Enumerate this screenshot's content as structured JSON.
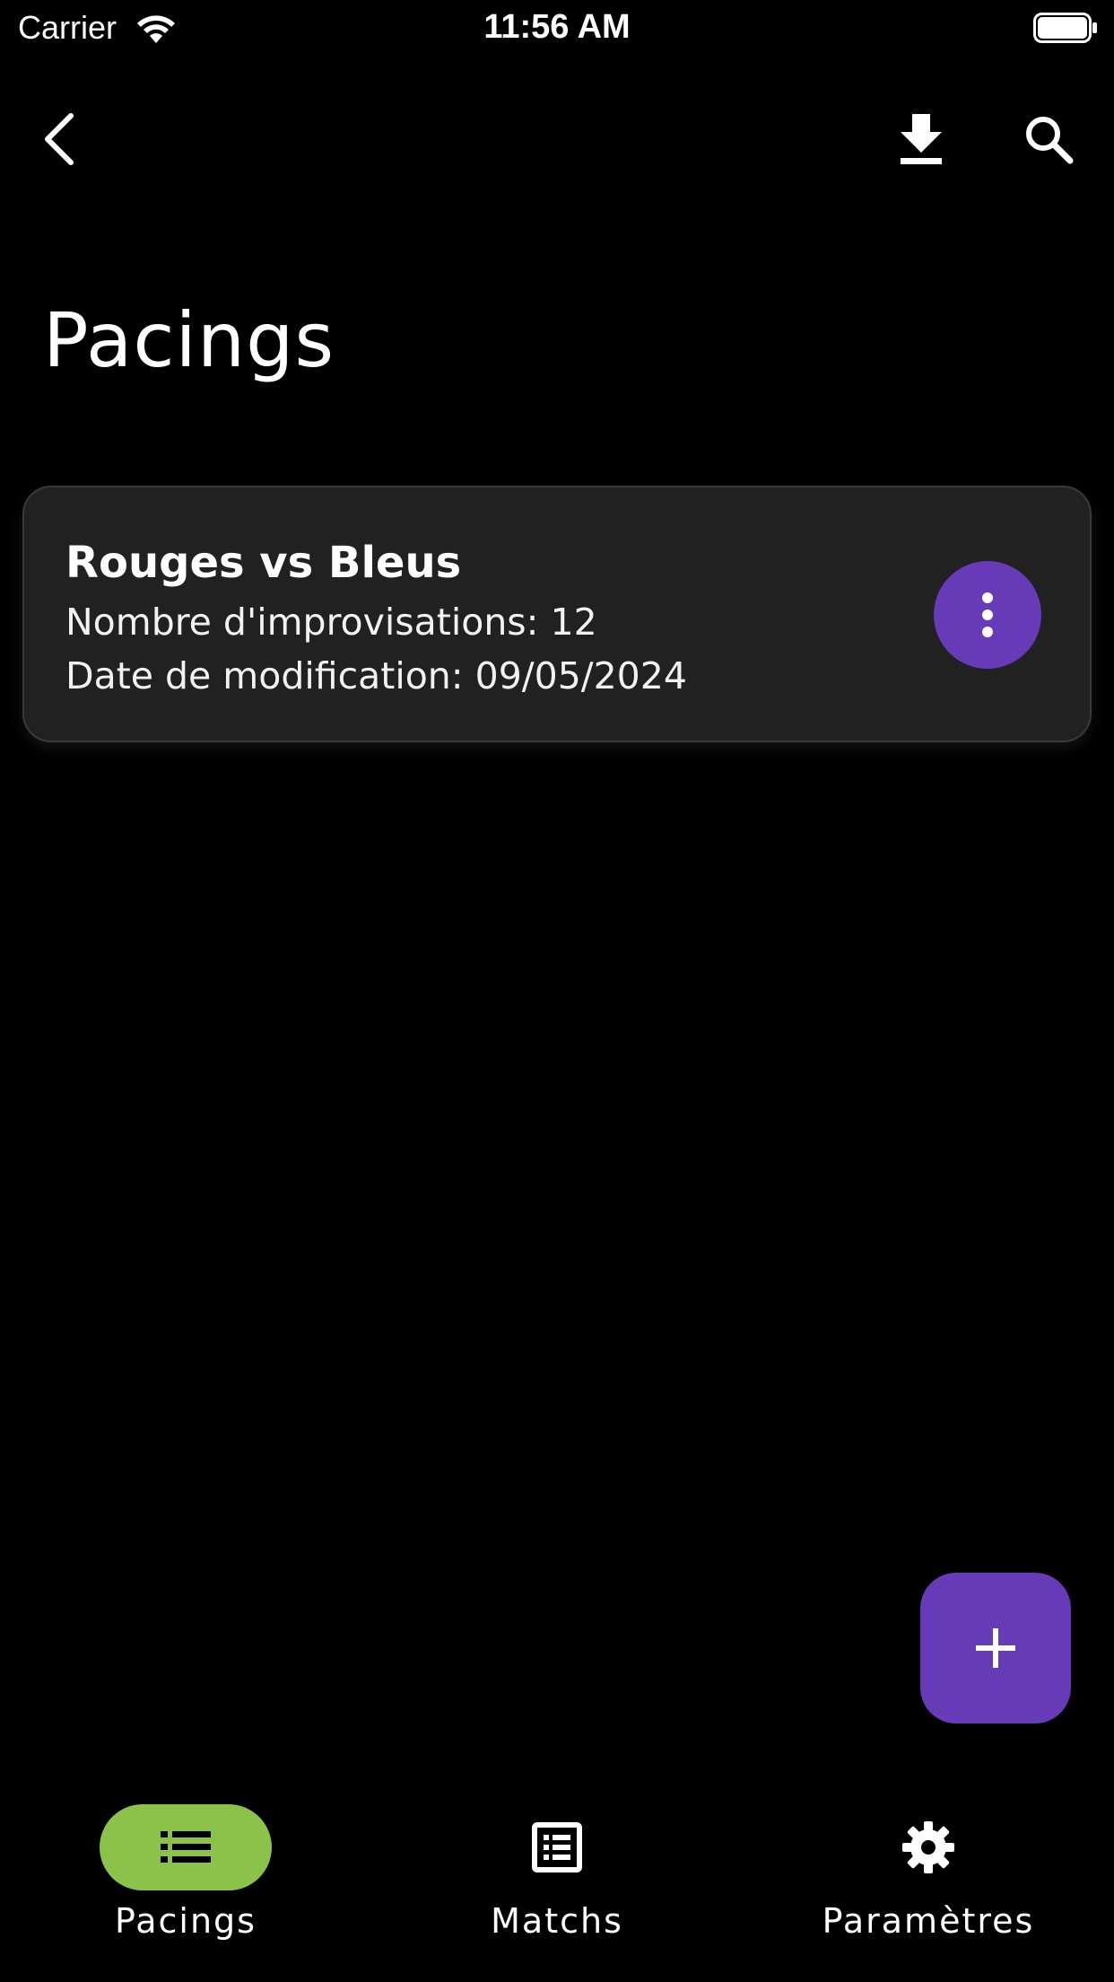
{
  "status_bar": {
    "carrier": "Carrier",
    "time": "11:56 AM"
  },
  "app_bar": {
    "back_icon": "arrow-back-icon",
    "download_icon": "download-icon",
    "search_icon": "search-icon"
  },
  "page": {
    "title": "Pacings"
  },
  "cards": [
    {
      "title": "Rouges vs Bleus",
      "line1": "Nombre d'improvisations: 12",
      "line2": "Date de modification: 09/05/2024",
      "menu_icon": "more-vert-icon"
    }
  ],
  "fab": {
    "icon": "add-icon"
  },
  "bottom_nav": {
    "items": [
      {
        "label": "Pacings",
        "icon": "list-icon",
        "active": true
      },
      {
        "label": "Matchs",
        "icon": "list-alt-icon",
        "active": false
      },
      {
        "label": "Paramètres",
        "icon": "settings-icon",
        "active": false
      }
    ]
  },
  "colors": {
    "background": "#000000",
    "card": "#212121",
    "accent_purple": "#673ab7",
    "active_green": "#8bc34a"
  }
}
